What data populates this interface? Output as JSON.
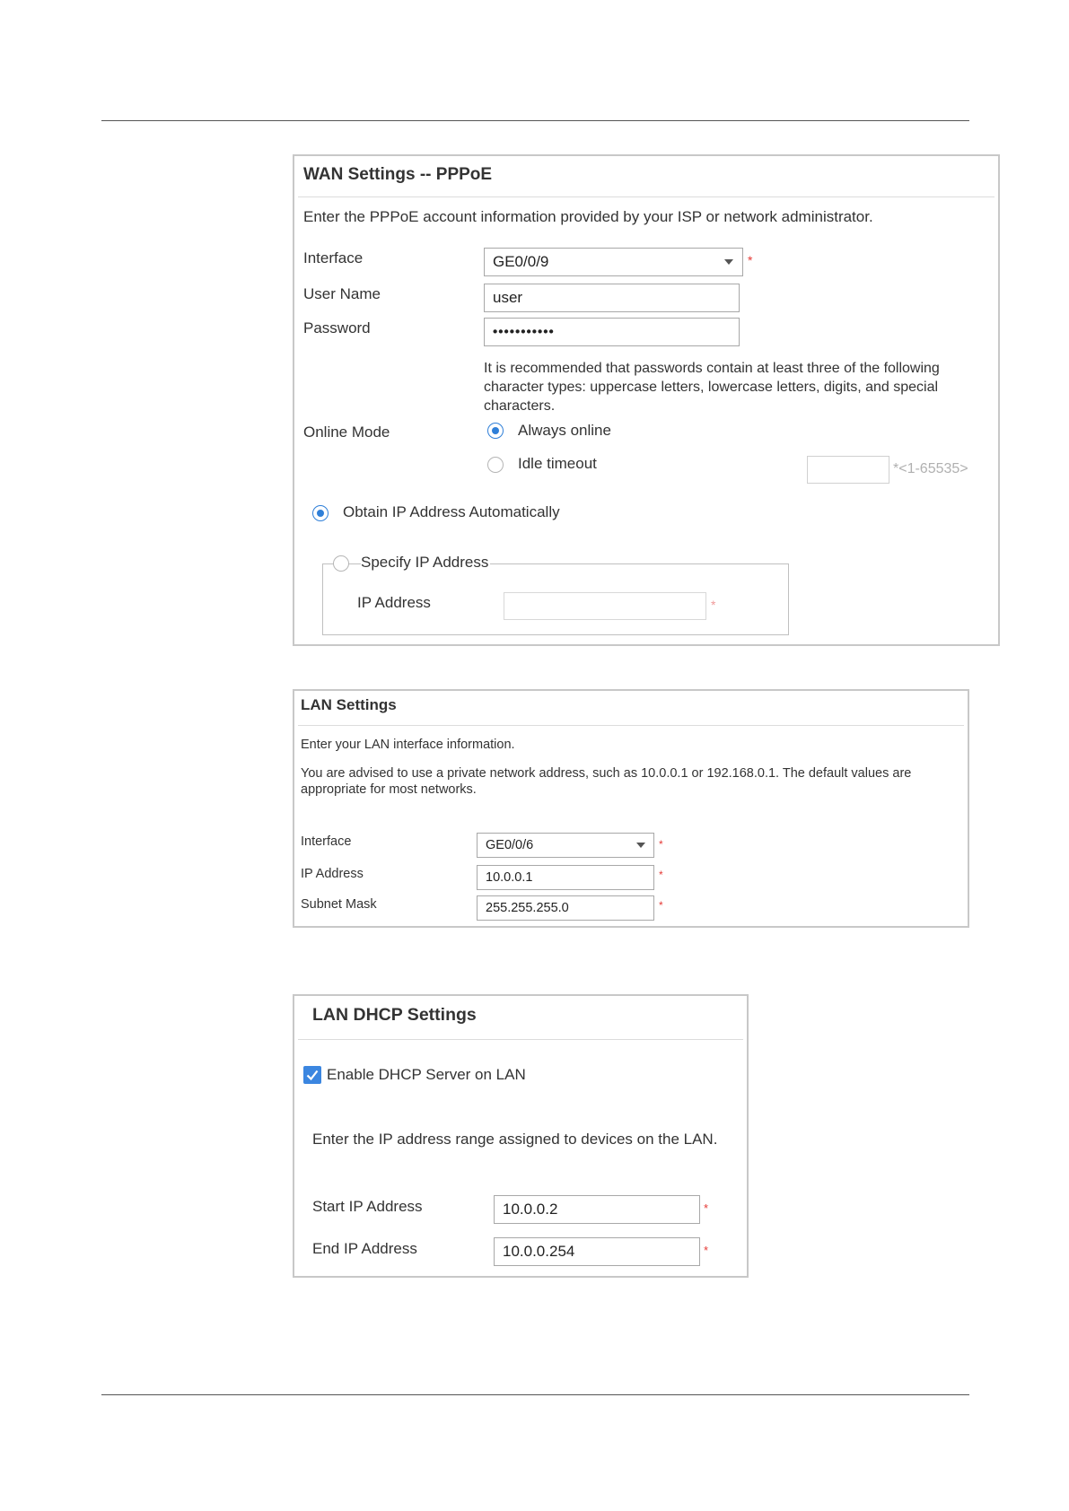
{
  "wan": {
    "title": "WAN Settings -- PPPoE",
    "description": "Enter the PPPoE account information provided by your ISP or network administrator.",
    "interface_label": "Interface",
    "interface_value": "GE0/0/9",
    "username_label": "User Name",
    "username_value": "user",
    "password_label": "Password",
    "password_value": "•••••••••••",
    "password_hint_1": "It is recommended that passwords contain at least three of the following",
    "password_hint_2": "character types: uppercase letters, lowercase letters, digits, and special",
    "password_hint_3": "characters.",
    "online_mode_label": "Online Mode",
    "always_online_label": "Always online",
    "idle_timeout_label": "Idle timeout",
    "idle_timeout_value": "",
    "idle_range_hint": "*<1-65535>",
    "obtain_ip_label": "Obtain IP Address Automatically",
    "specify_ip_label": "Specify IP Address",
    "ip_address_label": "IP Address",
    "ip_address_value": ""
  },
  "lan": {
    "title": "LAN Settings",
    "description": "Enter your LAN interface information.",
    "advice_1": "You are advised to use a private network address, such as 10.0.0.1 or 192.168.0.1. The default values are",
    "advice_2": "appropriate for most networks.",
    "interface_label": "Interface",
    "interface_value": "GE0/0/6",
    "ip_label": "IP Address",
    "ip_value": "10.0.0.1",
    "mask_label": "Subnet Mask",
    "mask_value": "255.255.255.0"
  },
  "dhcp": {
    "title": "LAN DHCP Settings",
    "enable_label": "Enable DHCP Server on LAN",
    "range_description": "Enter the IP address range assigned to devices on the LAN.",
    "start_label": "Start IP Address",
    "start_value": "10.0.0.2",
    "end_label": "End IP Address",
    "end_value": "10.0.0.254"
  },
  "required_mark": "*",
  "colors": {
    "accent": "#2f7fd8",
    "required": "#e53935",
    "border": "#c8c8c8"
  }
}
